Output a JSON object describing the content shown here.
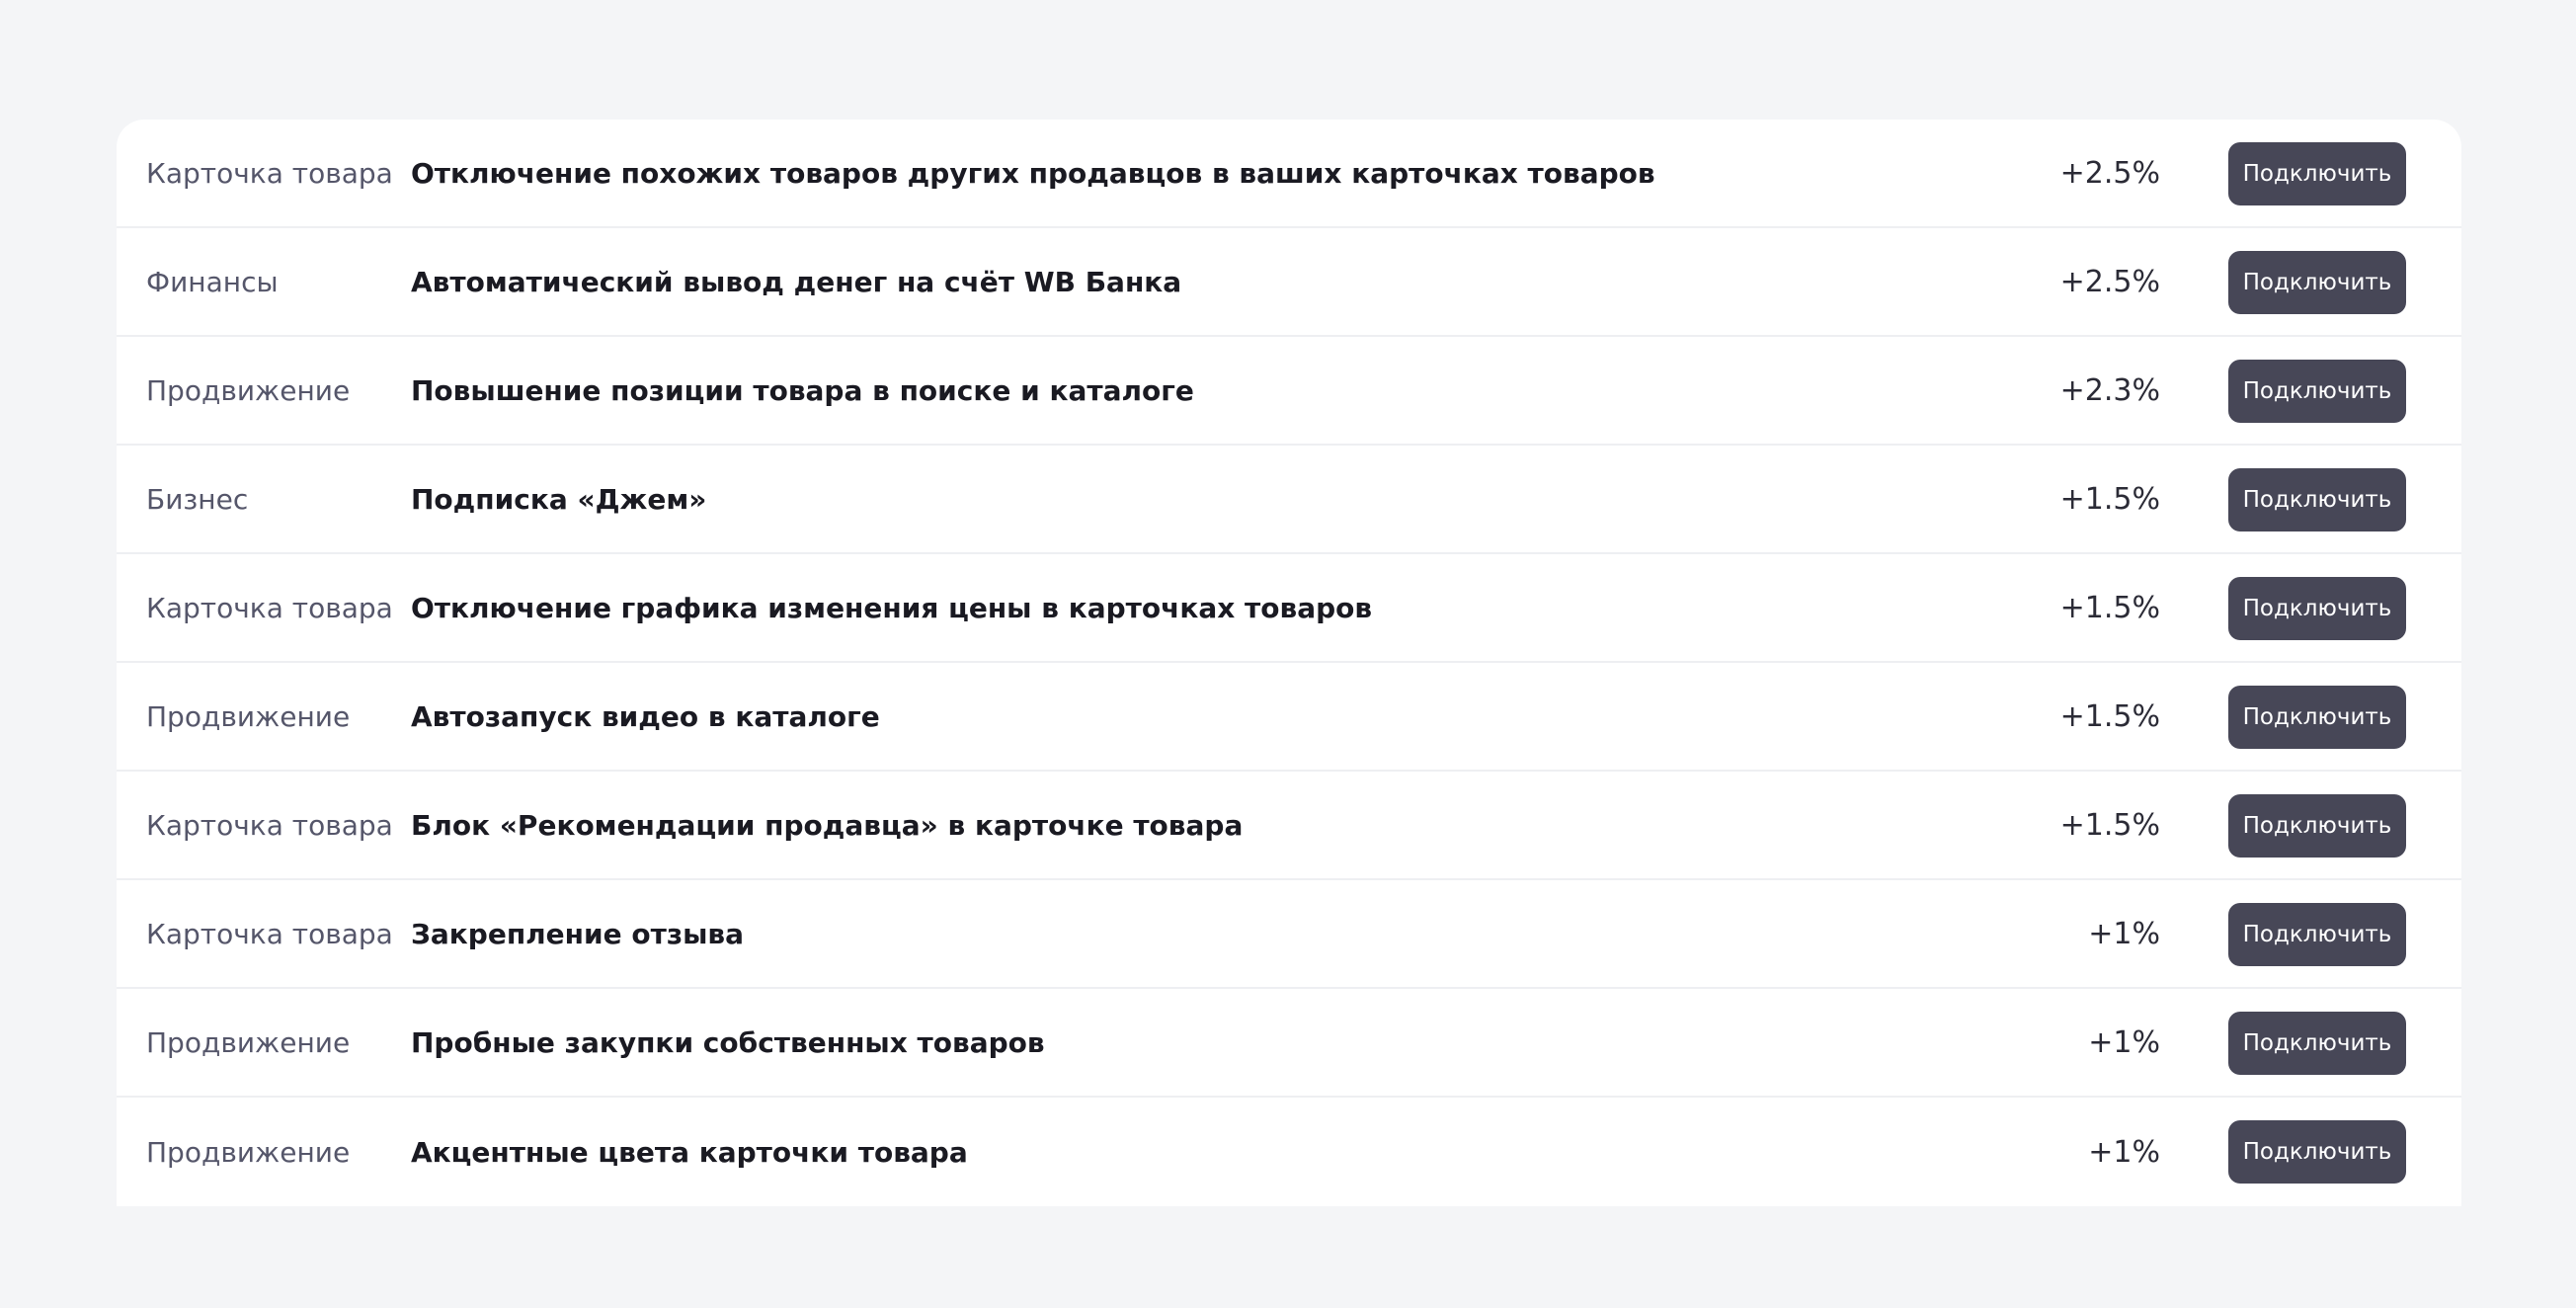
{
  "rows": [
    {
      "category": "Карточка товара",
      "title": "Отключение похожих товаров других продавцов в ваших карточках товаров",
      "percent": "+2.5%",
      "button": "Подключить"
    },
    {
      "category": "Финансы",
      "title": "Автоматический вывод денег на счёт WB Банка",
      "percent": "+2.5%",
      "button": "Подключить"
    },
    {
      "category": "Продвижение",
      "title": "Повышение позиции товара в поиске и каталоге",
      "percent": "+2.3%",
      "button": "Подключить"
    },
    {
      "category": "Бизнес",
      "title": "Подписка «Джем»",
      "percent": "+1.5%",
      "button": "Подключить"
    },
    {
      "category": "Карточка товара",
      "title": "Отключение графика изменения цены в карточках товаров",
      "percent": "+1.5%",
      "button": "Подключить"
    },
    {
      "category": "Продвижение",
      "title": "Автозапуск видео в каталоге",
      "percent": "+1.5%",
      "button": "Подключить"
    },
    {
      "category": "Карточка товара",
      "title": "Блок «Рекомендации продавца» в карточке товара",
      "percent": "+1.5%",
      "button": "Подключить"
    },
    {
      "category": "Карточка товара",
      "title": "Закрепление отзыва",
      "percent": "+1%",
      "button": "Подключить"
    },
    {
      "category": "Продвижение",
      "title": "Пробные закупки собственных товаров",
      "percent": "+1%",
      "button": "Подключить"
    },
    {
      "category": "Продвижение",
      "title": "Акцентные цвета карточки товара",
      "percent": "+1%",
      "button": "Подключить"
    }
  ],
  "colors": {
    "background": "#f4f5f7",
    "panel": "#ffffff",
    "button": "#474757",
    "button_text": "#ffffff",
    "category_text": "#55566a",
    "title_text": "#1a1a22"
  }
}
